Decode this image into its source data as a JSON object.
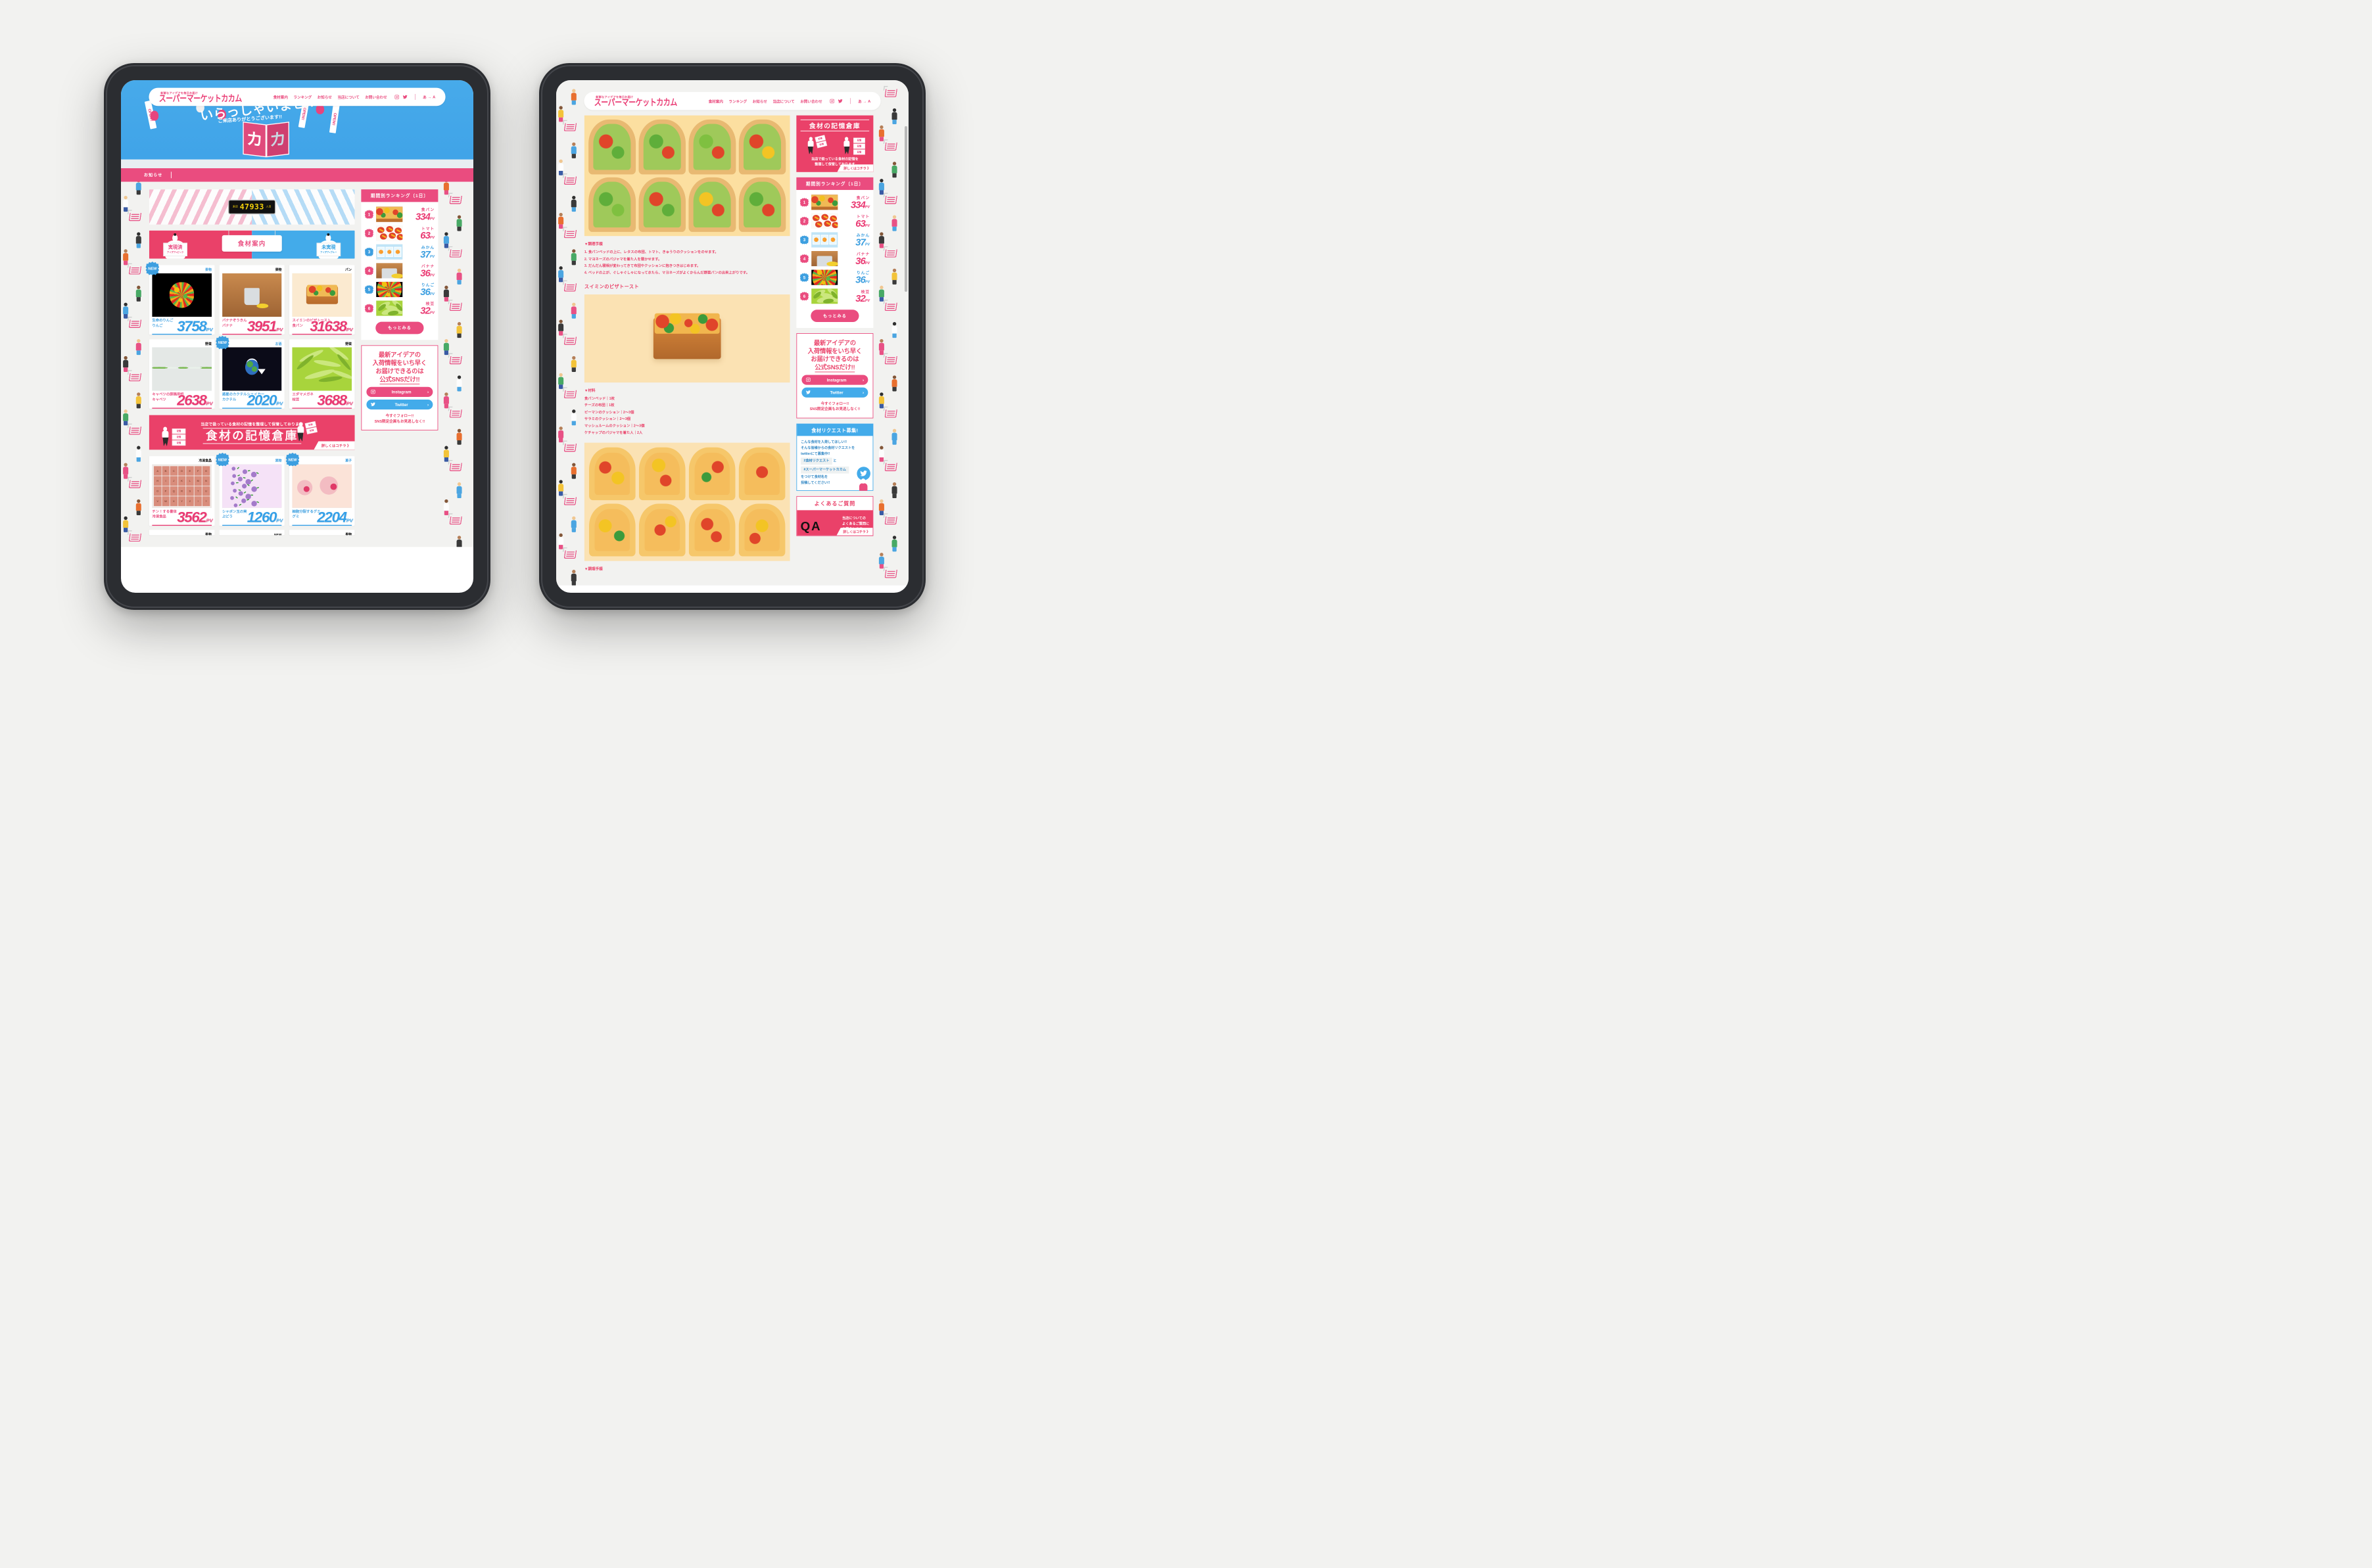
{
  "brand": {
    "tagline": "新鮮なアイデアを毎日お届け",
    "logo": "スーパーマーケットカカム"
  },
  "nav": {
    "items": [
      {
        "label": "食材案内"
      },
      {
        "label": "ランキング"
      },
      {
        "label": "お知らせ"
      },
      {
        "label": "当店について"
      },
      {
        "label": "お問い合わせ"
      }
    ],
    "instagram_icon": "instagram-icon",
    "twitter_icon": "twitter-icon",
    "lang_from": "あ",
    "lang_arrow": "→",
    "lang_to": "A"
  },
  "hero": {
    "title": "いらっしゃいませ!!",
    "subtitle": "ご来店ありがとうございます!!",
    "logo_mark": "カ",
    "logo_caption": "スーパーマーケットカカム",
    "flag_text": "OPEN!!"
  },
  "notice": {
    "label": "お知らせ"
  },
  "counter": {
    "prefix": "来店",
    "number": "47933",
    "suffix": "人目"
  },
  "tabs": {
    "left_big": "実現済",
    "left_small": "アイデア=ピンク",
    "center": "食材案内",
    "right_big": "未実現",
    "right_small": "アイデア=ブルー"
  },
  "products": [
    {
      "category": "果物",
      "name": "生命のりんご",
      "sub": "りんご",
      "pv": "3758",
      "unit": "PV",
      "color": "blue",
      "new": true,
      "art": "apple"
    },
    {
      "category": "果物",
      "name": "バナナぞうきん",
      "sub": "バナナ",
      "pv": "3951",
      "unit": "PV",
      "color": "pink",
      "new": false,
      "art": "banana"
    },
    {
      "category": "パン",
      "name": "スイミンのピザトースト",
      "sub": "食パン",
      "pv": "31638",
      "unit": "PV",
      "color": "pink",
      "new": false,
      "art": "toast"
    },
    {
      "category": "野菜",
      "name": "キャベツの原稿用紙",
      "sub": "キャベツ",
      "pv": "2638",
      "unit": "PV",
      "color": "pink",
      "new": false,
      "art": "cabbage"
    },
    {
      "category": "お酒",
      "name": "惑星のカクテルシェイカー",
      "sub": "カクテル",
      "pv": "2020",
      "unit": "PV",
      "color": "blue",
      "new": true,
      "art": "cocktail"
    },
    {
      "category": "野菜",
      "name": "エダマメガネ",
      "sub": "枝豆",
      "pv": "3688",
      "unit": "PV",
      "color": "pink",
      "new": false,
      "art": "edamame"
    },
    {
      "category": "冷凍食品",
      "name": "チン！する書体",
      "sub": "冷凍食品",
      "pv": "3562",
      "unit": "PV",
      "color": "pink",
      "new": false,
      "art": "alphabet"
    },
    {
      "category": "果物",
      "name": "シャボン玉の実",
      "sub": "ぶどう",
      "pv": "1260",
      "unit": "PV",
      "color": "blue",
      "new": true,
      "art": "grape"
    },
    {
      "category": "菓子",
      "name": "細胞分裂するグミ",
      "sub": "グミ",
      "pv": "2204",
      "unit": "PV",
      "color": "blue",
      "new": true,
      "art": "gummy"
    }
  ],
  "row_tail_categories": [
    "果物",
    "NEW",
    "果物",
    "調味料"
  ],
  "storage_banner": {
    "subtitle": "当店で扱っている食材の記憶を整理して保管しております",
    "title": "食材の記憶倉庫",
    "more": "詳しくはコチラ 》",
    "box_label": "記憶"
  },
  "ranking": {
    "title": "期間別ランキング〔1日〕",
    "more_label": "もっとみる",
    "items": [
      {
        "rank": "1",
        "name": "食パン",
        "pv": "334",
        "unit": "PV",
        "color": "pink",
        "art": "toast"
      },
      {
        "rank": "2",
        "name": "トマト",
        "pv": "63",
        "unit": "PV",
        "color": "pink",
        "art": "tomato"
      },
      {
        "rank": "3",
        "name": "みかん",
        "pv": "37",
        "unit": "PV",
        "color": "blue",
        "art": "mikan"
      },
      {
        "rank": "4",
        "name": "バナナ",
        "pv": "36",
        "unit": "PV",
        "color": "pink",
        "art": "banana"
      },
      {
        "rank": "5",
        "name": "りんご",
        "pv": "36",
        "unit": "PV",
        "color": "blue",
        "art": "apple"
      },
      {
        "rank": "6",
        "name": "枝豆",
        "pv": "32",
        "unit": "PV",
        "color": "pink",
        "art": "edamame"
      }
    ]
  },
  "sns_widget": {
    "line1": "最新アイデアの",
    "line2": "入荷情報をいち早く",
    "line3": "お届けできるのは",
    "line4": "公式SNSだけ!!",
    "instagram": "Instagram",
    "twitter": "Twitter",
    "chevron": "›",
    "foot1": "今すぐフォロー!!",
    "foot2": "SNS限定企画もお見逃しなく!!"
  },
  "memory_widget": {
    "title": "食材の記憶倉庫",
    "caption1": "当店で扱っている食材の記憶を",
    "caption2": "整理して保管しております",
    "more": "詳しくはコチラ 》",
    "box_label": "記憶"
  },
  "request_widget": {
    "title": "食材リクエスト募集!",
    "line1": "こんな食材を入荷してほしい!!",
    "line2": "そんな皆様からの食材リクエストを",
    "line3": "twitterにて募集中!!",
    "tag1": "#食材リクエスト",
    "and": "と",
    "tag2": "#スーパーマーケットカカム",
    "line4": "をつけて食材名を",
    "line5": "投稿してください!!"
  },
  "qa_widget": {
    "title": "よくあるご質問",
    "mark_q": "Q",
    "mark_a": "A",
    "text1": "当店についての",
    "text2": "よくあるご質問に",
    "text3": "お答えします。",
    "more": "詳しくはコチラ 》"
  },
  "article": {
    "steps_heading": "▼調理手順",
    "steps": [
      "1. 食パンベッドの上に、レタスの布団、トマト、きゅうりのクッションをのせます。",
      "2. マヨネーズのパジャマを着た人を寝かせます。",
      "3. だんだん寝相が変わってきて布団やクッションに抱きつきはじめます。",
      "4. ベッドの上が、ぐしゃぐしゃになってきたら、マヨネーズがよくからんだ野菜パンの出来上がりです。"
    ],
    "recipe_title": "スイミンのピザトースト",
    "ingredients_heading": "▼材料",
    "ingredients": [
      "食パンベッド｜1枚",
      "チーズの布団｜1枚",
      "ピーマンのクッション｜2〜3個",
      "サラミのクッション｜2〜3個",
      "マッシュルームのクッション｜2〜3個",
      "ケチャップのパジャマを着た人｜2人"
    ],
    "steps_heading2": "▼調理手順"
  }
}
